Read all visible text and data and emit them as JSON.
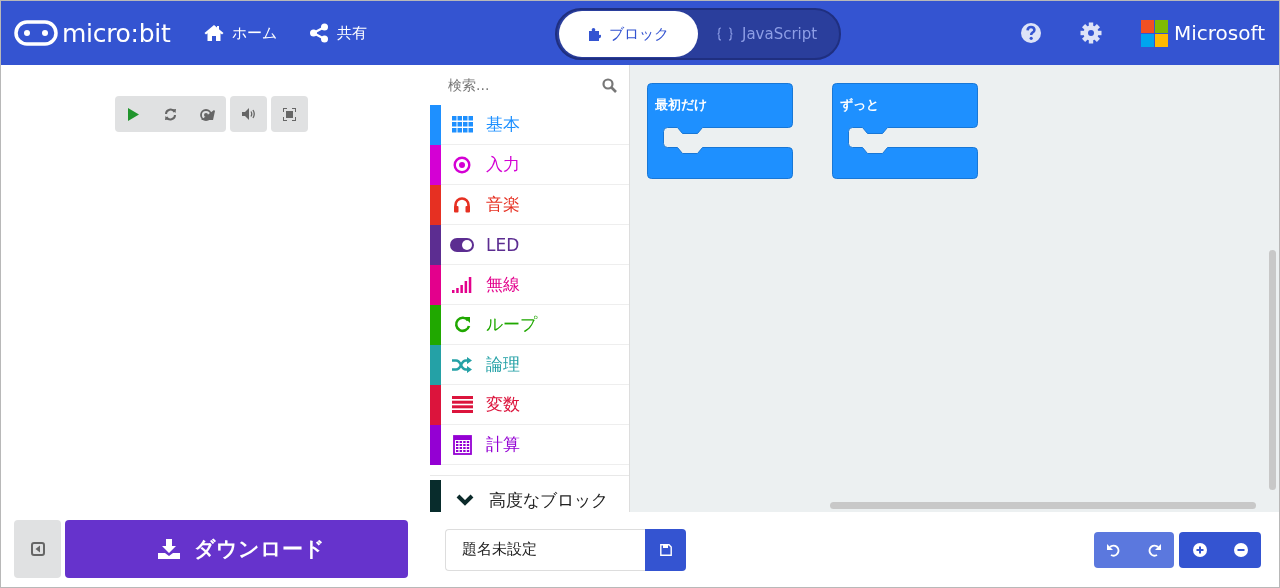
{
  "header": {
    "logo": "micro:bit",
    "nav": [
      {
        "label": "ホーム",
        "kind": "home"
      },
      {
        "label": "共有",
        "kind": "share"
      }
    ],
    "modes": [
      {
        "label": "ブロック",
        "kind": "puzzle",
        "selected": true
      },
      {
        "label": "JavaScript",
        "kind": "code",
        "selected": false
      }
    ],
    "brand": "Microsoft"
  },
  "simulator": {
    "download": "ダウンロード"
  },
  "toolbox": {
    "search": {
      "placeholder": "検索..."
    },
    "categories": [
      {
        "label": "基本",
        "kind": "grid",
        "color": "#1e90ff"
      },
      {
        "label": "入力",
        "kind": "target",
        "color": "#d400d4"
      },
      {
        "label": "音楽",
        "kind": "headphones",
        "color": "#e63022"
      },
      {
        "label": "LED",
        "kind": "toggle",
        "color": "#5c2d91"
      },
      {
        "label": "無線",
        "kind": "signal",
        "color": "#e3008c"
      },
      {
        "label": "ループ",
        "kind": "loop",
        "color": "#20a800"
      },
      {
        "label": "論理",
        "kind": "shuffle",
        "color": "#24a1a6"
      },
      {
        "label": "変数",
        "kind": "lines",
        "color": "#dc143c"
      },
      {
        "label": "計算",
        "kind": "calculator",
        "color": "#9400d3"
      }
    ],
    "advanced": {
      "label": "高度なブロック",
      "color": "#082c2c"
    }
  },
  "workspace": {
    "blocks": [
      {
        "label": "最初だけ"
      },
      {
        "label": "ずっと"
      }
    ]
  },
  "project": {
    "name": "題名未設定"
  }
}
